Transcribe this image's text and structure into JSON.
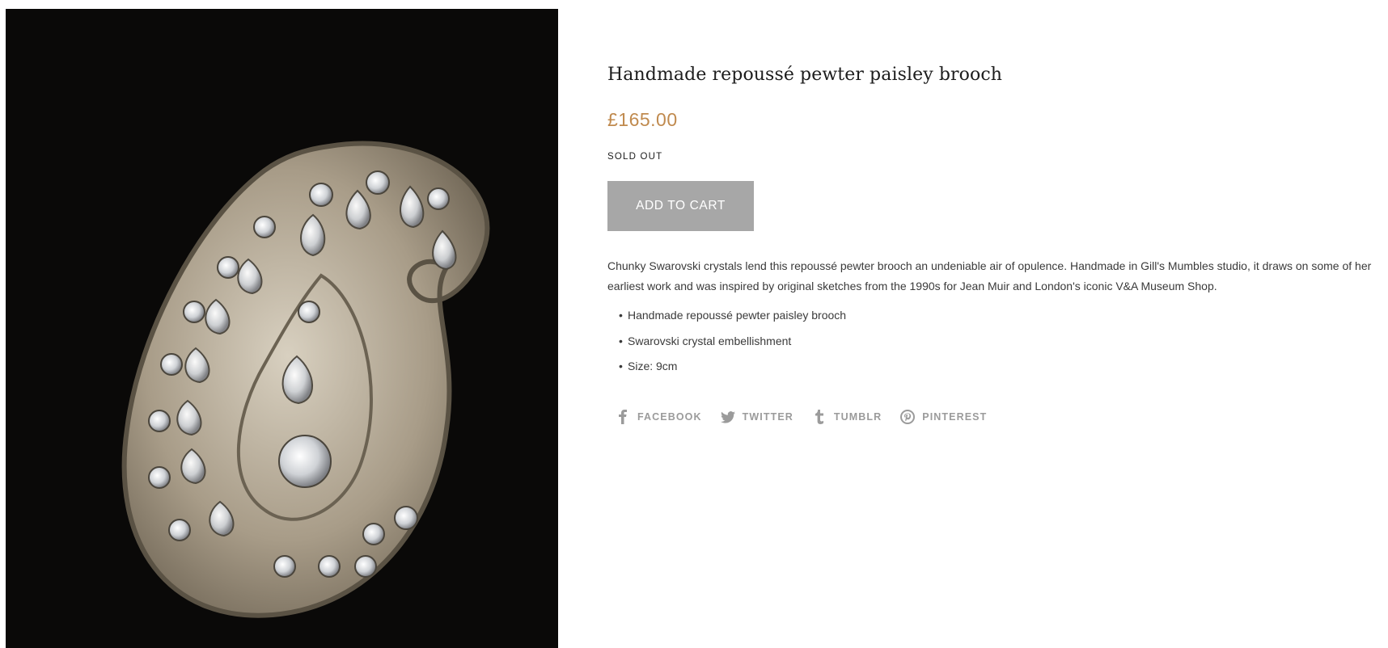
{
  "product": {
    "title": "Handmade repoussé pewter paisley brooch",
    "price": "£165.00",
    "stock_status": "SOLD OUT",
    "add_to_cart_label": "ADD TO CART",
    "description": "Chunky Swarovski crystals lend this repoussé pewter brooch an undeniable air of opulence. Handmade in Gill's Mumbles studio, it draws on some of her earliest work and was inspired by original sketches from the 1990s for Jean Muir and London's iconic V&A Museum Shop.",
    "features": [
      "Handmade repoussé pewter paisley brooch",
      "Swarovski crystal embellishment",
      "Size: 9cm"
    ]
  },
  "share": [
    {
      "label": "FACEBOOK",
      "icon": "facebook-icon"
    },
    {
      "label": "TWITTER",
      "icon": "twitter-icon"
    },
    {
      "label": "TUMBLR",
      "icon": "tumblr-icon"
    },
    {
      "label": "PINTEREST",
      "icon": "pinterest-icon"
    }
  ],
  "colors": {
    "price": "#c08a4e",
    "button_bg": "#a7a7a7",
    "share_text": "#9b9b9b",
    "image_bg": "#0a0908"
  }
}
